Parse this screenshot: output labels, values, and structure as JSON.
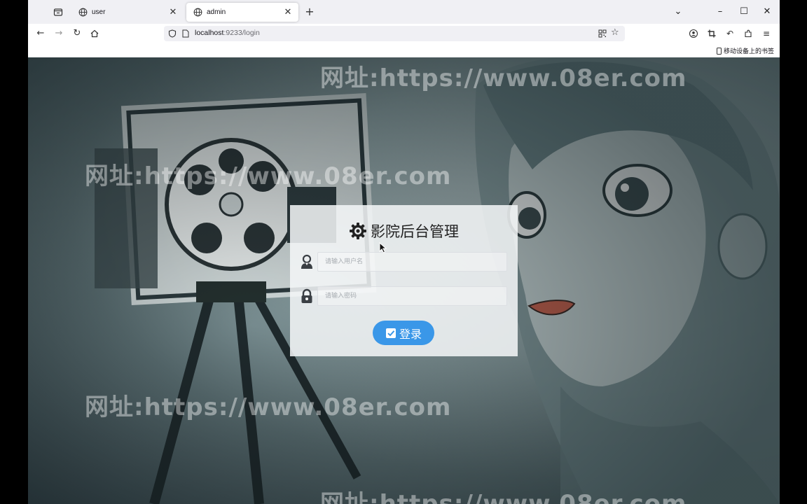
{
  "browser": {
    "tabs": [
      {
        "label": "user",
        "active": false
      },
      {
        "label": "admin",
        "active": true
      }
    ],
    "url": {
      "host": "localhost",
      "rest": ":9233/login"
    },
    "bookmarks_bar": {
      "mobile_bookmarks_label": "移动设备上的书签"
    }
  },
  "page": {
    "watermark_text": "网址:https://www.08er.com",
    "login": {
      "title": "影院后台管理",
      "username_placeholder": "请输入用户名",
      "password_placeholder": "请输入密码",
      "submit_label": "登录"
    }
  },
  "colors": {
    "accent_button": "#3a97e8",
    "tab_strip": "#f0f0f4"
  }
}
